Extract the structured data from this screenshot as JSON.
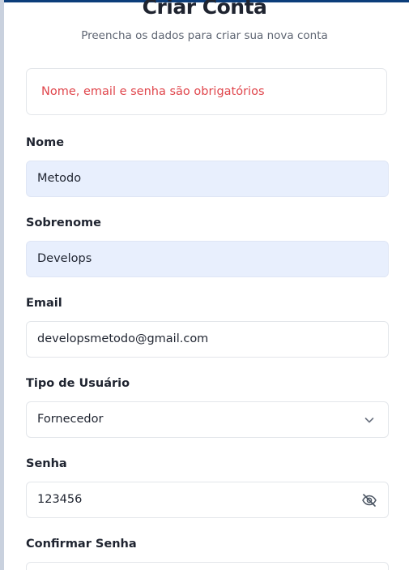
{
  "header": {
    "title": "Criar Conta",
    "subtitle": "Preencha os dados para criar sua nova conta"
  },
  "alert": {
    "message": "Nome, email e senha são obrigatórios",
    "color": "#e0464c"
  },
  "form": {
    "nome": {
      "label": "Nome",
      "value": "Metodo"
    },
    "sobrenome": {
      "label": "Sobrenome",
      "value": "Develops"
    },
    "email": {
      "label": "Email",
      "value": "developsmetodo@gmail.com"
    },
    "tipo_usuario": {
      "label": "Tipo de Usuário",
      "value": "Fornecedor",
      "icon": "chevron-down-icon"
    },
    "senha": {
      "label": "Senha",
      "value": "123456",
      "icon": "eye-off-icon"
    },
    "confirmar_senha": {
      "label": "Confirmar Senha"
    }
  },
  "colors": {
    "accent_bar": "#0b3d7a",
    "autofill_bg": "#e8effd"
  }
}
